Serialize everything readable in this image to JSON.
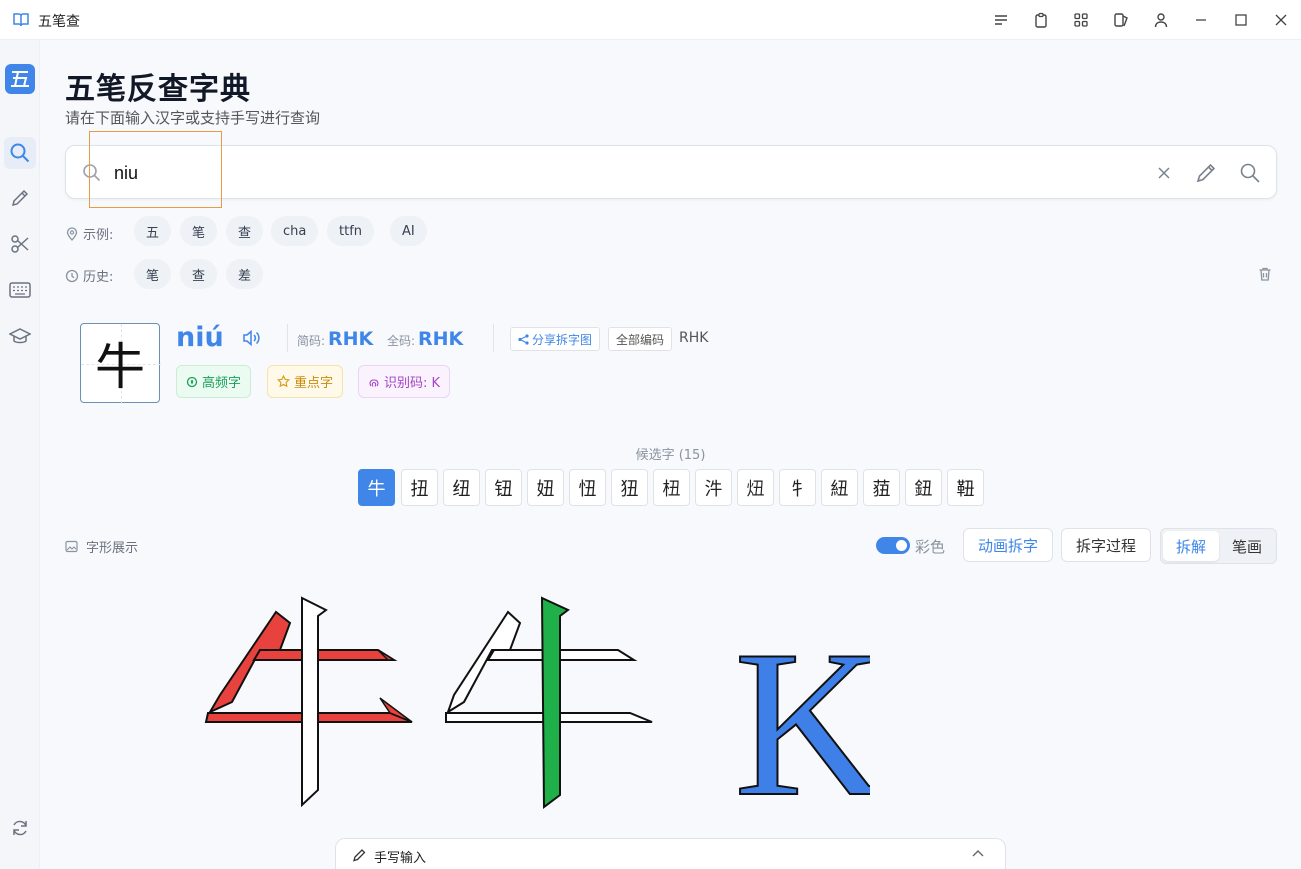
{
  "window": {
    "title": "五笔查"
  },
  "page": {
    "title": "五笔反查字典",
    "subtitle": "请在下面输入汉字或支持手写进行查询"
  },
  "search": {
    "value": "niu",
    "placeholder": ""
  },
  "examples": {
    "label": "示例:",
    "items": [
      "五",
      "笔",
      "查",
      "cha",
      "ttfn",
      "AI"
    ]
  },
  "history": {
    "label": "历史:",
    "items": [
      "笔",
      "查",
      "差"
    ]
  },
  "result": {
    "character": "牛",
    "pinyin": "niú",
    "short_code_label": "简码:",
    "short_code": "RHK",
    "full_code_label": "全码:",
    "full_code": "RHK",
    "share_label": "分享拆字图",
    "all_codes_label": "全部编码",
    "all_codes_value": "RHK",
    "badges": [
      "高频字",
      "重点字",
      "识别码: K"
    ]
  },
  "candidates": {
    "title": "候选字 (15)",
    "items": [
      "牛",
      "扭",
      "纽",
      "钮",
      "妞",
      "忸",
      "狃",
      "杻",
      "汼",
      "炄",
      "牜",
      "紐",
      "莥",
      "鈕",
      "靵"
    ]
  },
  "glyph": {
    "section_label": "字形展示",
    "color_toggle_label": "彩色",
    "color_on": true,
    "animate_button": "动画拆字",
    "process_button": "拆字过程",
    "tab_split": "拆解",
    "tab_stroke": "笔画",
    "code_letter": "K",
    "colors": {
      "red": "#e8423f",
      "green": "#1fb04a",
      "blue": "#3f7fe8"
    }
  },
  "handwriting": {
    "label": "手写输入"
  },
  "colors": {
    "accent": "#3f86e8"
  }
}
